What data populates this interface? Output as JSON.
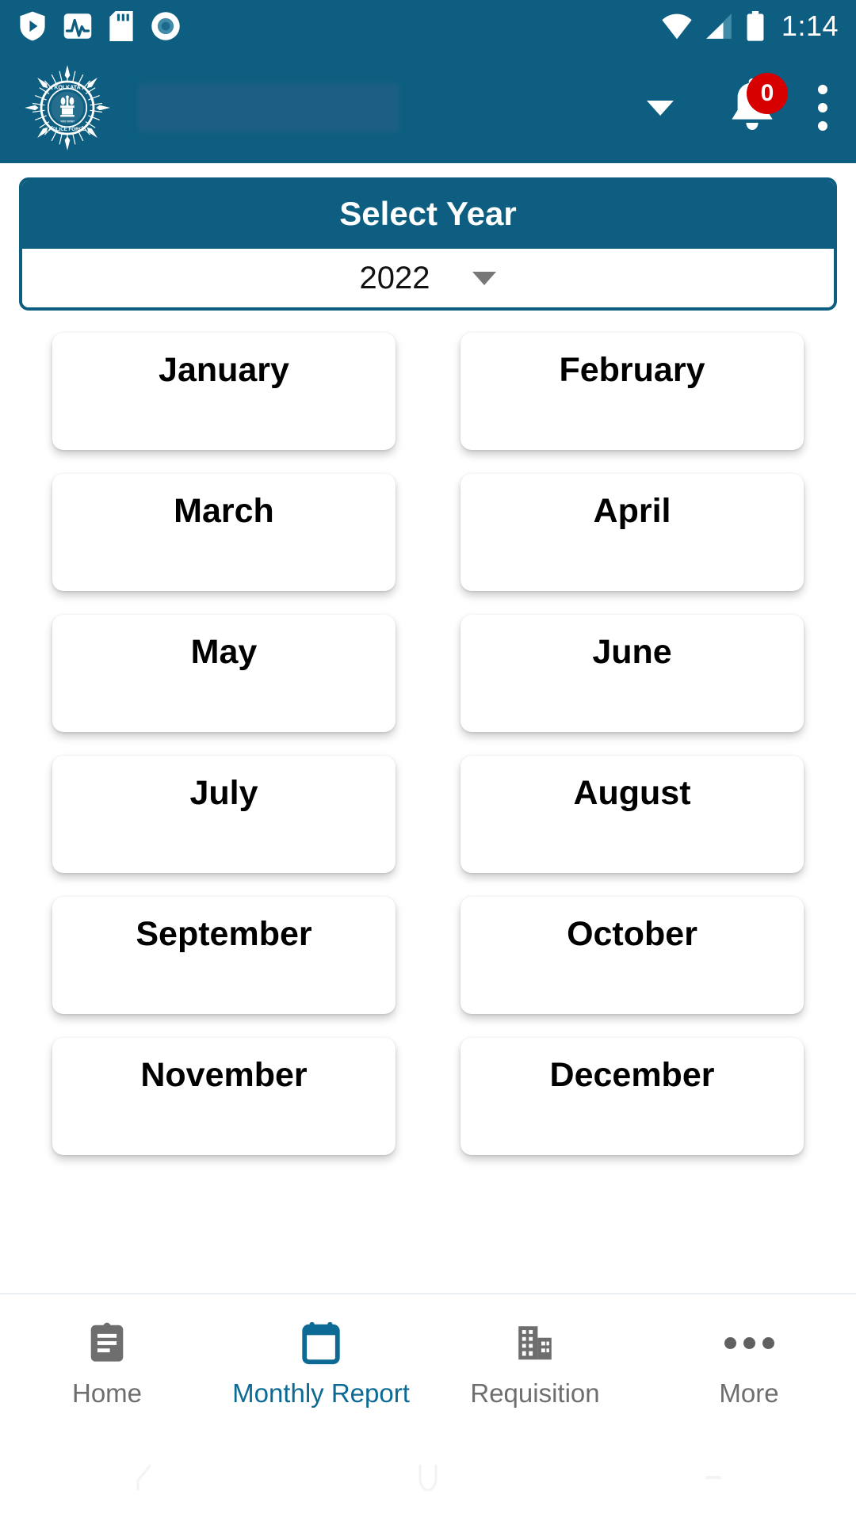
{
  "status_bar": {
    "time": "1:14",
    "left_icons": [
      {
        "name": "shield-play-icon"
      },
      {
        "name": "activity-pulse-icon"
      },
      {
        "name": "sd-card-icon"
      },
      {
        "name": "record-circle-icon"
      }
    ],
    "right_icons": [
      {
        "name": "wifi-icon"
      },
      {
        "name": "cellular-signal-icon"
      },
      {
        "name": "battery-icon"
      }
    ]
  },
  "app_bar": {
    "logo_alt": "Kolkata Police Force emblem",
    "title": "",
    "title_redacted": true,
    "notification_count": "0",
    "icons": {
      "dropdown": "chevron-down-icon",
      "bell": "notification-bell-icon",
      "overflow": "overflow-menu-icon"
    }
  },
  "year_selector": {
    "header_label": "Select Year",
    "selected_year": "2022",
    "dropdown_icon": "caret-down-icon"
  },
  "months": [
    {
      "label": "January"
    },
    {
      "label": "February"
    },
    {
      "label": "March"
    },
    {
      "label": "April"
    },
    {
      "label": "May"
    },
    {
      "label": "June"
    },
    {
      "label": "July"
    },
    {
      "label": "August"
    },
    {
      "label": "September"
    },
    {
      "label": "October"
    },
    {
      "label": "November"
    },
    {
      "label": "December"
    }
  ],
  "bottom_nav": {
    "items": [
      {
        "label": "Home",
        "icon": "clipboard-icon",
        "active": false
      },
      {
        "label": "Monthly Report",
        "icon": "calendar-icon",
        "active": true
      },
      {
        "label": "Requisition",
        "icon": "building-icon",
        "active": false
      },
      {
        "label": "More",
        "icon": "ellipsis-icon",
        "active": false
      }
    ]
  },
  "android_nav": {
    "back": "back-icon",
    "home": "home-icon",
    "recents": "recents-icon"
  },
  "colors": {
    "primary": "#0d5e80",
    "accent": "#0d6a94",
    "badge": "#d60000",
    "inactive": "#6e6e6e",
    "card": "#ffffff",
    "page_bg": "#ffffff"
  }
}
